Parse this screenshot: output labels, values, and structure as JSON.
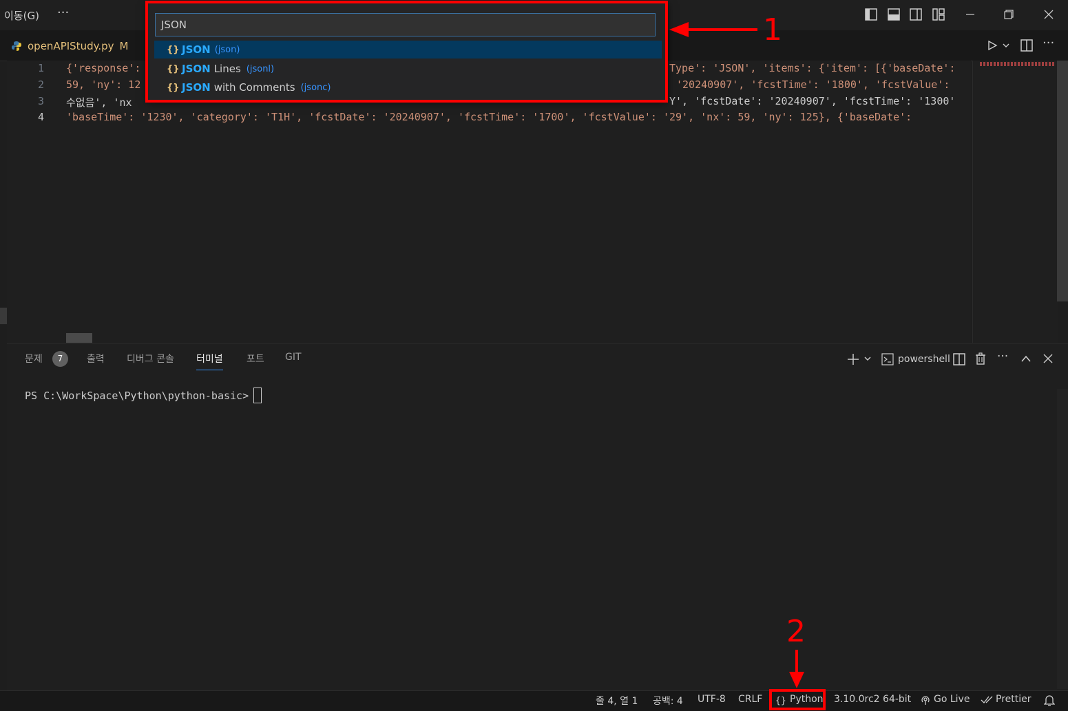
{
  "titlebar": {
    "menu_label": "이동(G)",
    "more_label": "···"
  },
  "tab": {
    "filename": "openAPIStudy.py",
    "status": "M"
  },
  "editor": {
    "line_numbers": [
      "1",
      "2",
      "3",
      "4"
    ],
    "lines": [
      {
        "left": "{'response':",
        "right": "Type': 'JSON', 'items': {'item': [{'baseDate':"
      },
      {
        "left": "59, 'ny': 12",
        "right": "'20240907', 'fcstTime': '1800', 'fcstValue':"
      },
      {
        "left": "수없음', 'nx",
        "right": "Y', 'fcstDate': '20240907', 'fcstTime': '1300'"
      },
      {
        "full": "'baseTime': '1230', 'category': 'T1H', 'fcstDate': '20240907', 'fcstTime': '1700', 'fcstValue': '29', 'nx': 59, 'ny': 125}, {'baseDate':"
      }
    ]
  },
  "quickpick": {
    "input_value": "JSON",
    "items": [
      {
        "icon": "{}",
        "match": "JSON",
        "rest": "",
        "desc": "(json)"
      },
      {
        "icon": "{}",
        "match": "JSON",
        "rest": "Lines",
        "desc": "(jsonl)"
      },
      {
        "icon": "{}",
        "match": "JSON",
        "rest": "with Comments",
        "desc": "(jsonc)"
      }
    ]
  },
  "panel": {
    "tabs": [
      "문제",
      "출력",
      "디버그 콘솔",
      "터미널",
      "포트",
      "GIT"
    ],
    "problems_count": "7",
    "active_tab": "터미널",
    "shell_name": "powershell",
    "prompt": "PS C:\\WorkSpace\\Python\\python-basic>"
  },
  "statusbar": {
    "position": "줄 4, 열 1",
    "spaces": "공백: 4",
    "encoding": "UTF-8",
    "eol": "CRLF",
    "language": "Python",
    "interpreter": "3.10.0rc2 64-bit",
    "golive": "Go Live",
    "prettier": "Prettier"
  },
  "annotations": {
    "label_1": "1",
    "label_2": "2",
    "color": "#ff0000"
  },
  "icons": {
    "layout": [
      "layout-sidebar-left-icon",
      "layout-panel-icon",
      "layout-sidebar-right-icon",
      "customize-layout-icon"
    ],
    "window": [
      "minimize-icon",
      "restore-icon",
      "close-icon"
    ],
    "editor_actions": [
      "run-icon",
      "chevron-down-icon",
      "split-editor-icon",
      "more-icon"
    ],
    "panel_actions": [
      "add-terminal-icon",
      "chevron-down-icon",
      "terminal-icon",
      "split-terminal-icon",
      "trash-icon",
      "more-icon",
      "maximize-panel-icon",
      "close-panel-icon"
    ],
    "status": [
      "braces-icon",
      "broadcast-icon",
      "check-all-icon",
      "bell-icon"
    ]
  }
}
